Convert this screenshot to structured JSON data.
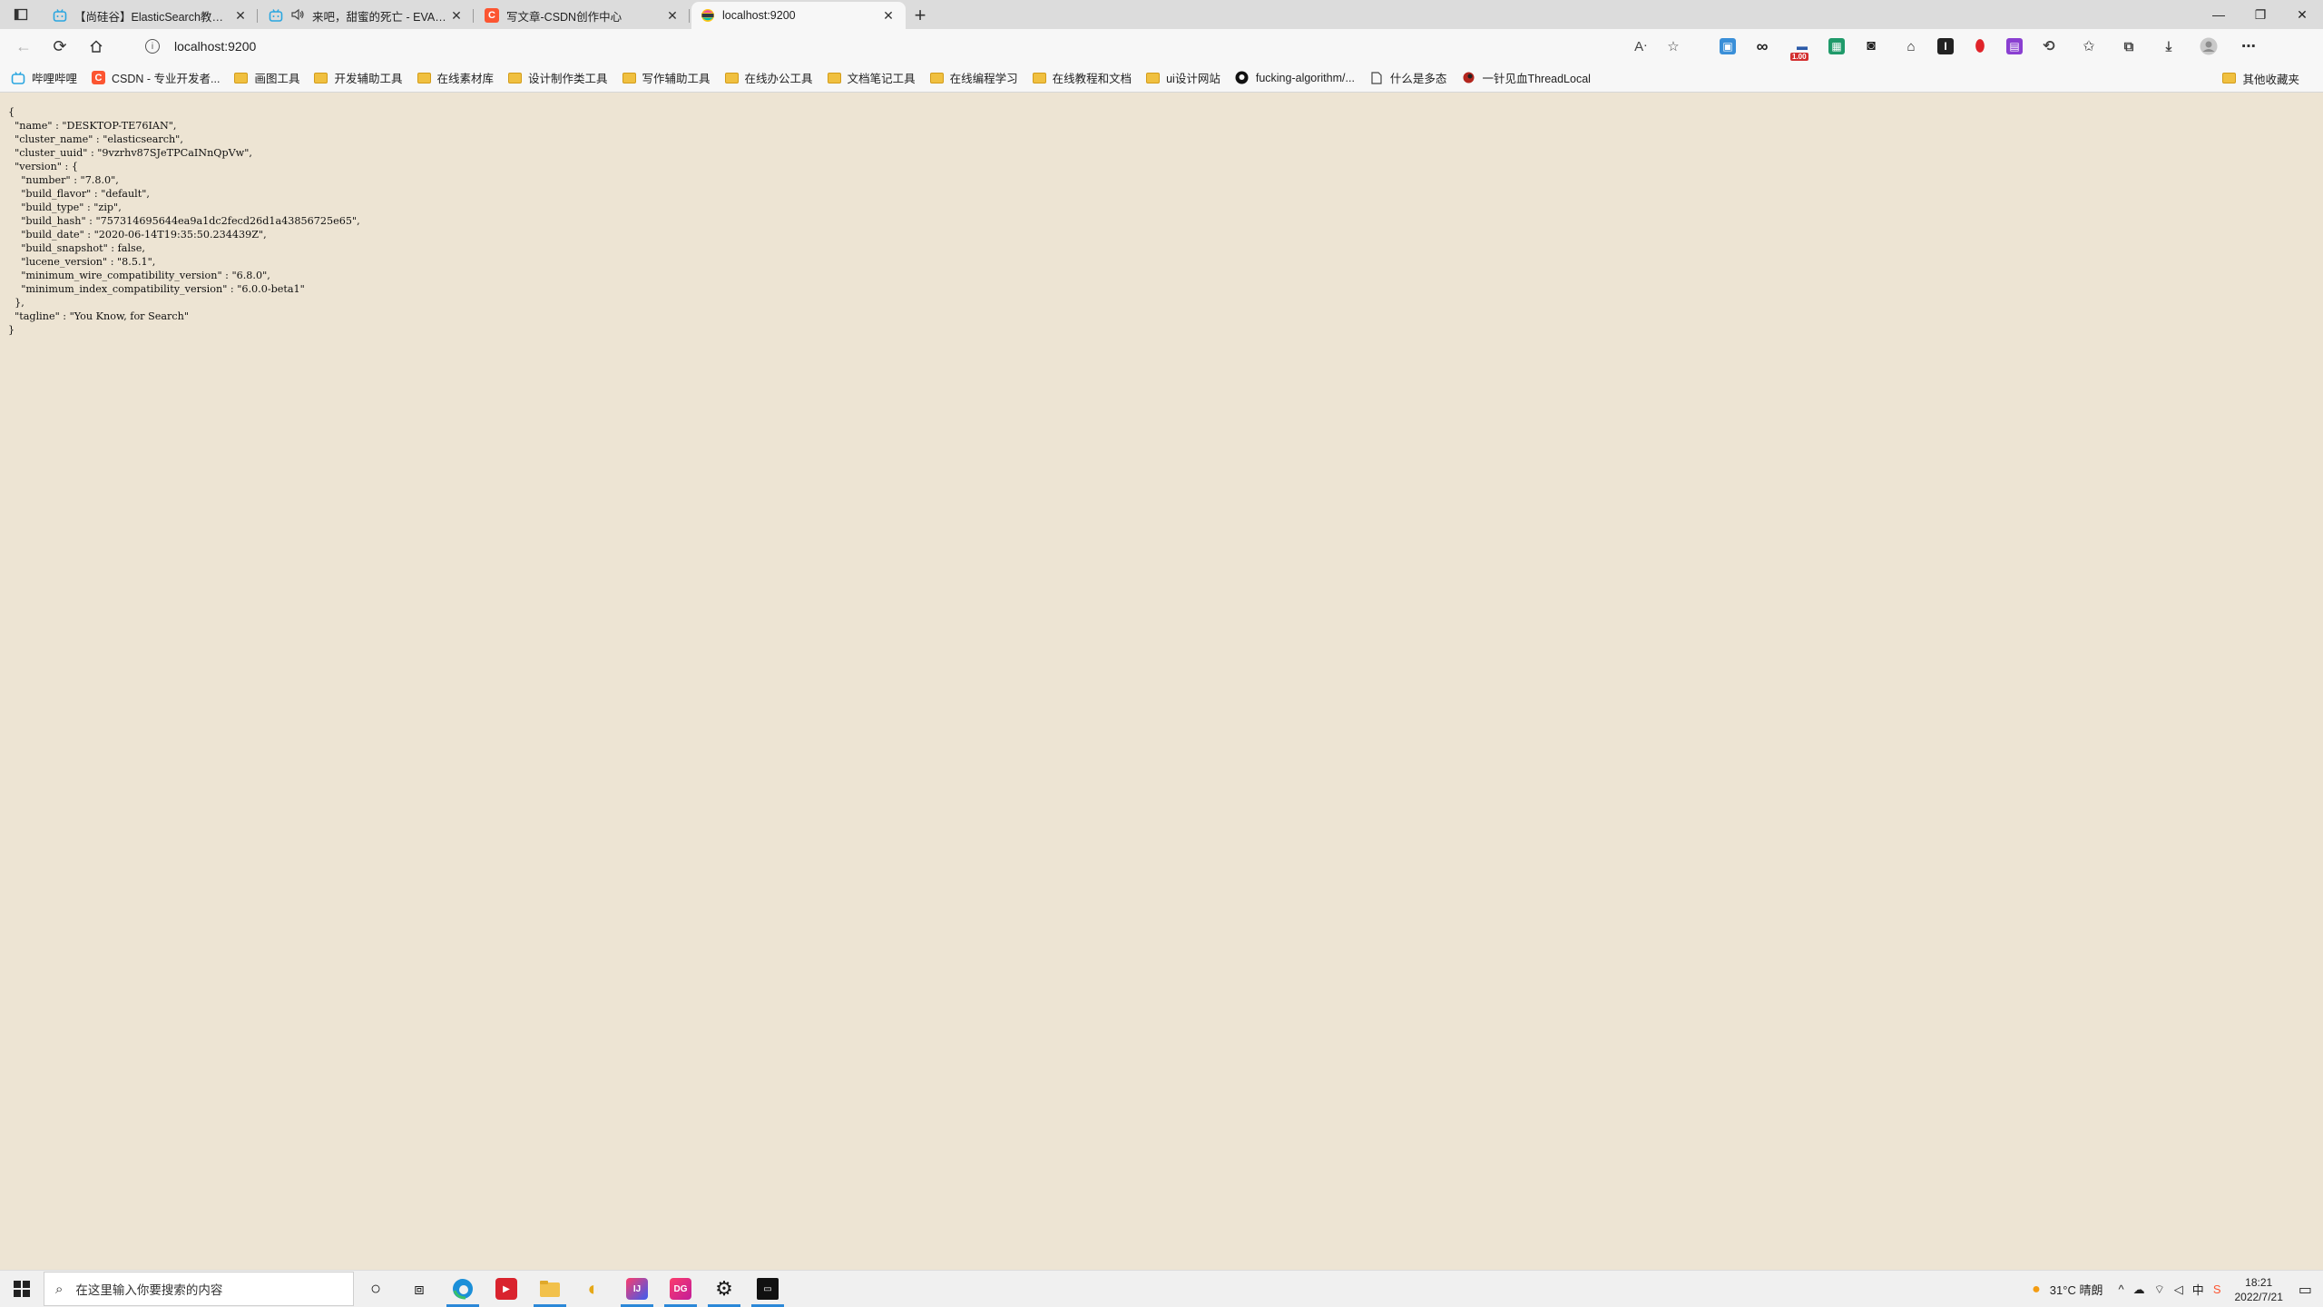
{
  "browser": {
    "tabs": [
      {
        "title": "【尚硅谷】ElasticSearch教程入门到精通",
        "favicon": "bilibili",
        "active": false,
        "audio": false
      },
      {
        "title": "来吧，甜蜜的死亡 - EVA插曲",
        "favicon": "bilibili",
        "active": false,
        "audio": true
      },
      {
        "title": "写文章-CSDN创作中心",
        "favicon": "csdn",
        "active": false,
        "audio": false
      },
      {
        "title": "localhost:9200",
        "favicon": "elastic",
        "active": true,
        "audio": false
      }
    ],
    "address": "localhost:9200",
    "bookmarks": [
      {
        "label": "哔哩哔哩",
        "icon": "bilibili"
      },
      {
        "label": "CSDN - 专业开发者...",
        "icon": "csdn"
      },
      {
        "label": "画图工具",
        "icon": "folder"
      },
      {
        "label": "开发辅助工具",
        "icon": "folder"
      },
      {
        "label": "在线素材库",
        "icon": "folder"
      },
      {
        "label": "设计制作类工具",
        "icon": "folder"
      },
      {
        "label": "写作辅助工具",
        "icon": "folder"
      },
      {
        "label": "在线办公工具",
        "icon": "folder"
      },
      {
        "label": "文档笔记工具",
        "icon": "folder"
      },
      {
        "label": "在线编程学习",
        "icon": "folder"
      },
      {
        "label": "在线教程和文档",
        "icon": "folder"
      },
      {
        "label": "ui设计网站",
        "icon": "folder"
      },
      {
        "label": "fucking-algorithm/...",
        "icon": "github"
      },
      {
        "label": "什么是多态",
        "icon": "page"
      },
      {
        "label": "一针见血ThreadLocal",
        "icon": "site"
      }
    ],
    "other_bookmarks": "其他收藏夹",
    "extension_badge": "1.00"
  },
  "page": {
    "json_lines": [
      "{",
      "  \"name\" : \"DESKTOP-TE76IAN\",",
      "  \"cluster_name\" : \"elasticsearch\",",
      "  \"cluster_uuid\" : \"9vzrhv87SJeTPCaINnQpVw\",",
      "  \"version\" : {",
      "    \"number\" : \"7.8.0\",",
      "    \"build_flavor\" : \"default\",",
      "    \"build_type\" : \"zip\",",
      "    \"build_hash\" : \"757314695644ea9a1dc2fecd26d1a43856725e65\",",
      "    \"build_date\" : \"2020-06-14T19:35:50.234439Z\",",
      "    \"build_snapshot\" : false,",
      "    \"lucene_version\" : \"8.5.1\",",
      "    \"minimum_wire_compatibility_version\" : \"6.8.0\",",
      "    \"minimum_index_compatibility_version\" : \"6.0.0-beta1\"",
      "  },",
      "  \"tagline\" : \"You Know, for Search\"",
      "}"
    ]
  },
  "taskbar": {
    "search_placeholder": "在这里输入你要搜索的内容",
    "weather": "31°C 晴朗",
    "time": "18:21",
    "date": "2022/7/21"
  }
}
